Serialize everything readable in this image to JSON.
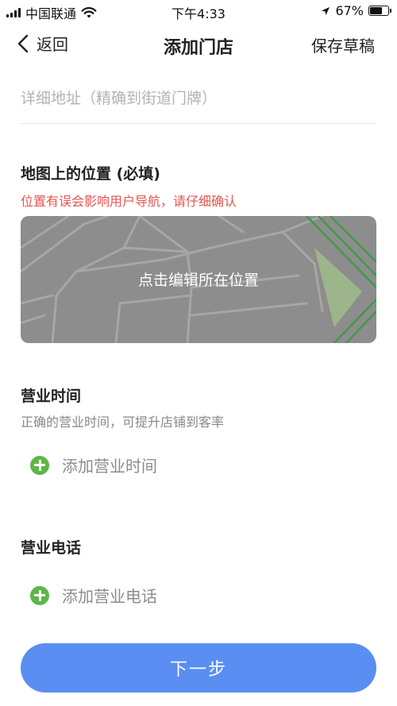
{
  "status_bar": {
    "carrier": "中国联通",
    "time": "下午4:33",
    "battery_percent": "67%"
  },
  "nav": {
    "back_label": "返回",
    "title": "添加门店",
    "save_draft": "保存草稿"
  },
  "address": {
    "placeholder": "详细地址（精确到街道门牌）",
    "value": ""
  },
  "map_section": {
    "title": "地图上的位置 (必填)",
    "warning": "位置有误会影响用户导航，请仔细确认",
    "map_label": "点击编辑所在位置"
  },
  "hours_section": {
    "title": "营业时间",
    "hint": "正确的营业时间，可提升店铺到客率",
    "add_label": "添加营业时间"
  },
  "phone_section": {
    "title": "营业电话",
    "add_label": "添加营业电话"
  },
  "footer": {
    "next_label": "下一步"
  },
  "colors": {
    "accent_blue": "#5b8ef2",
    "add_green": "#5fb548",
    "warning_red": "#e8544f",
    "map_gray": "#8d8d8d"
  }
}
